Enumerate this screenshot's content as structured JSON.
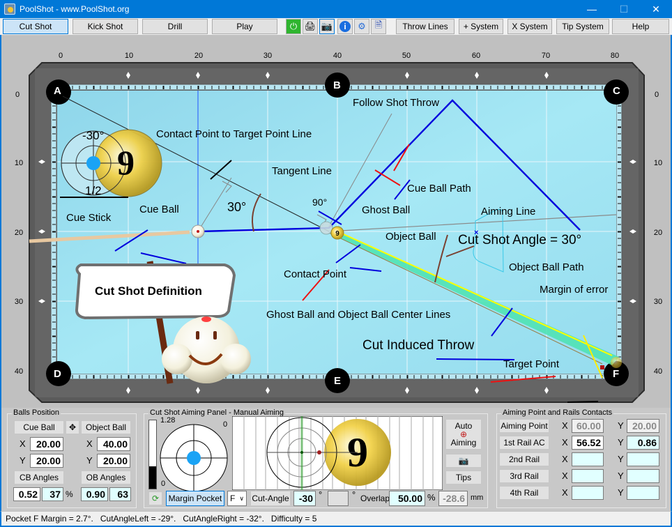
{
  "window": {
    "title": "PoolShot - www.PoolShot.org"
  },
  "toolbar": {
    "buttons": [
      "Cut Shot",
      "Kick Shot",
      "Drill",
      "Play"
    ],
    "icons": [
      "power-icon",
      "print-icon",
      "camera-icon",
      "info-icon",
      "settings-icon",
      "help-doc-icon"
    ],
    "right_buttons": [
      "Throw Lines",
      "+ System",
      "X System",
      "Tip System",
      "Help"
    ]
  },
  "axes": {
    "x_ticks": [
      "0",
      "10",
      "20",
      "30",
      "40",
      "50",
      "60",
      "70",
      "80"
    ],
    "y_ticks": [
      "0",
      "10",
      "20",
      "30",
      "40"
    ]
  },
  "table": {
    "pockets": [
      "A",
      "B",
      "C",
      "D",
      "E",
      "F"
    ],
    "labels": {
      "contact_line": "Contact Point to Target Point Line",
      "follow": "Follow Shot Throw",
      "tangent": "Tangent Line",
      "cue_path": "Cue Ball Path",
      "ghost": "Ghost Ball",
      "aiming": "Aiming Line",
      "object": "Object Ball",
      "cut_angle": "Cut Shot Angle = 30°",
      "cue_stick": "Cue Stick",
      "cue_ball": "Cue Ball",
      "angle30": "30°",
      "angle90": "90°",
      "contact": "Contact Point",
      "ob_path": "Object Ball Path",
      "margin": "Margin of error",
      "centerlines": "Ghost Ball and Object Ball Center Lines",
      "throw": "Cut Induced Throw",
      "target": "Target Point",
      "sign": "Cut Shot Definition",
      "inset_angle": "-30°",
      "inset_frac": "1/2",
      "ball_number": "9"
    }
  },
  "balls_position": {
    "legend": "Balls Position",
    "cue_ball_btn": "Cue Ball",
    "object_ball_btn": "Object Ball",
    "cb_x": "20.00",
    "cb_y": "20.00",
    "ob_x": "40.00",
    "ob_y": "20.00",
    "x_label": "X",
    "y_label": "Y",
    "cb_angles_btn": "CB Angles",
    "ob_angles_btn": "OB Angles",
    "cb_angle1": "0.52",
    "cb_angle2": "37",
    "pct": "%",
    "ob_angle1": "0.90",
    "ob_angle2": "63"
  },
  "aiming_panel": {
    "legend": "Cut Shot Aiming Panel - Manual Aiming",
    "scale_top": "1.28",
    "scale_bottom": "0",
    "zero_label": "0",
    "auto_top": "Auto",
    "auto_bottom": "Aiming",
    "tips_btn": "Tips",
    "margin_pocket_btn": "Margin Pocket",
    "pocket_select": "F",
    "cut_angle_btn": "Cut-Angle",
    "cut_angle_value": "-30",
    "deg": "°",
    "second_value": "",
    "overlap_label": "Overlap",
    "overlap_value": "50.00",
    "overlap_unit": "%",
    "mm_value": "-28.6",
    "mm_unit": "mm"
  },
  "aiming_rails": {
    "legend": "Aiming Point  and  Rails Contacts",
    "rows": [
      {
        "label": "Aiming Point",
        "x": "60.00",
        "y": "20.00"
      },
      {
        "label": "1st Rail AC",
        "x": "56.52",
        "y": "0.86"
      },
      {
        "label": "2nd Rail",
        "x": "",
        "y": ""
      },
      {
        "label": "3rd Rail",
        "x": "",
        "y": ""
      },
      {
        "label": "4th Rail",
        "x": "",
        "y": ""
      }
    ]
  },
  "status": {
    "text": "Pocket F Margin = 2.7°.   CutAngleLeft = -29°.   CutAngleRight = -32°.   Difficulty = 5"
  },
  "colors": {
    "felt": "#9fe3f2",
    "accent": "#0078d7",
    "path": "#0000dd",
    "ob_path": "#4be3b0"
  }
}
